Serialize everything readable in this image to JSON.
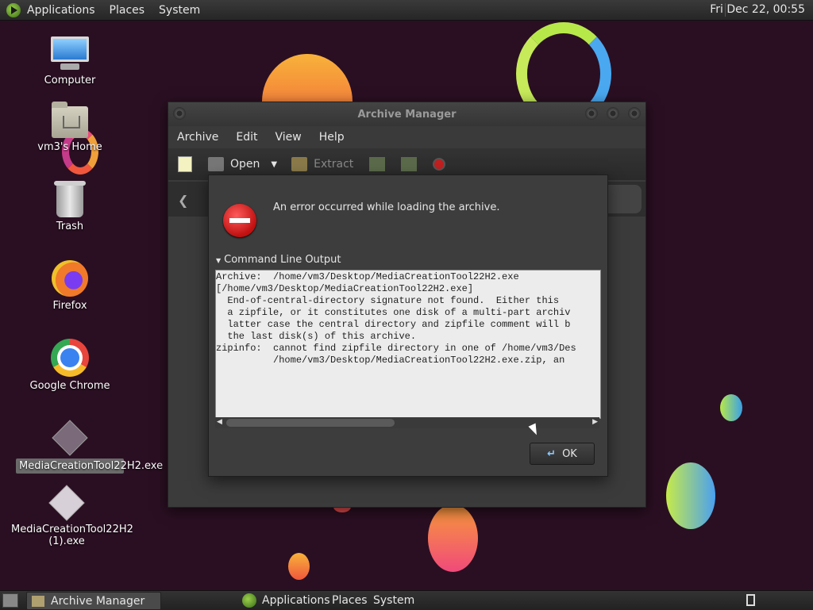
{
  "top_panel": {
    "menus": [
      "Applications",
      "Places",
      "System"
    ],
    "clock": "Fri Dec 22, 00:55"
  },
  "desktop_icons": [
    {
      "label": "Computer",
      "icon": "computer-icon"
    },
    {
      "label": "vm3's Home",
      "icon": "home-folder-icon"
    },
    {
      "label": "Trash",
      "icon": "trash-icon"
    },
    {
      "label": "Firefox",
      "icon": "firefox-icon"
    },
    {
      "label": "Google Chrome",
      "icon": "chrome-icon"
    },
    {
      "label": "MediaCreationTool22H2.exe",
      "icon": "exe-file-icon",
      "selected": true
    },
    {
      "label": "MediaCreationTool22H2 (1).exe",
      "icon": "exe-file-icon"
    }
  ],
  "window": {
    "title": "Archive Manager",
    "menu": [
      "Archive",
      "Edit",
      "View",
      "Help"
    ],
    "toolbar": {
      "open_label": "Open",
      "extract_label": "Extract"
    }
  },
  "dialog": {
    "message": "An error occurred while loading the archive.",
    "expander_label": "Command Line Output",
    "output_lines": [
      "Archive:  /home/vm3/Desktop/MediaCreationTool22H2.exe",
      "[/home/vm3/Desktop/MediaCreationTool22H2.exe]",
      "  End-of-central-directory signature not found.  Either this",
      "  a zipfile, or it constitutes one disk of a multi-part archiv",
      "  latter case the central directory and zipfile comment will b",
      "  the last disk(s) of this archive.",
      "zipinfo:  cannot find zipfile directory in one of /home/vm3/Des",
      "          /home/vm3/Desktop/MediaCreationTool22H2.exe.zip, an"
    ],
    "ok_label": "OK"
  },
  "bottom_panel": {
    "task_label": "Archive Manager",
    "menus": [
      "Applications",
      "Places",
      "System"
    ]
  },
  "colors": {
    "desktop_bg": "#2a0f22",
    "panel": "#2e2e2e",
    "error_red": "#d01818"
  }
}
